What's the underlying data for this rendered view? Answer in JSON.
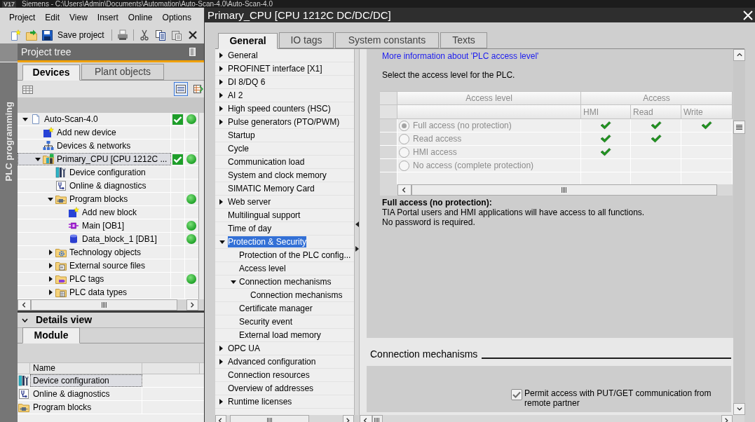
{
  "app": {
    "logo": "V17",
    "title": "Siemens - C:\\Users\\Admin\\Documents\\Automation\\Auto-Scan-4.0\\Auto-Scan-4.0",
    "menu": [
      "Project",
      "Edit",
      "View",
      "Insert",
      "Online",
      "Options"
    ],
    "toolbar": {
      "save_label": "Save project"
    },
    "portal": "PLC programming"
  },
  "project_tree": {
    "title": "Project tree",
    "tabs": [
      {
        "label": "Devices",
        "selected": true
      },
      {
        "label": "Plant objects",
        "selected": false
      }
    ],
    "view_buttons": [
      {
        "kind": "list",
        "selected": true
      },
      {
        "kind": "table",
        "selected": false
      }
    ],
    "items": [
      {
        "label": "Auto-Scan-4.0",
        "kind": "project",
        "expanded": true,
        "selected": false,
        "compiled_ok": true,
        "online_ok": true,
        "children": [
          {
            "label": "Add new device",
            "kind": "add_device",
            "selected": false,
            "compiled_ok": false,
            "online_ok": false
          },
          {
            "label": "Devices & networks",
            "kind": "network",
            "selected": false,
            "compiled_ok": false,
            "online_ok": false
          },
          {
            "label": "Primary_CPU [CPU 1212C ...",
            "kind": "cpu",
            "expanded": true,
            "selected": true,
            "compiled_ok": true,
            "online_ok": true,
            "children": [
              {
                "label": "Device configuration",
                "kind": "config",
                "selected": false,
                "compiled_ok": false,
                "online_ok": false
              },
              {
                "label": "Online & diagnostics",
                "kind": "diagnostics",
                "selected": false,
                "compiled_ok": false,
                "online_ok": false
              },
              {
                "label": "Program blocks",
                "kind": "blocks_folder",
                "expanded": true,
                "selected": false,
                "compiled_ok": false,
                "online_ok": true,
                "children": [
                  {
                    "label": "Add new block",
                    "kind": "add_block",
                    "selected": false,
                    "compiled_ok": false,
                    "online_ok": false
                  },
                  {
                    "label": "Main [OB1]",
                    "kind": "ob",
                    "selected": false,
                    "compiled_ok": false,
                    "online_ok": true
                  },
                  {
                    "label": "Data_block_1 [DB1]",
                    "kind": "db",
                    "selected": false,
                    "compiled_ok": false,
                    "online_ok": true
                  }
                ]
              },
              {
                "label": "Technology objects",
                "kind": "tech_folder",
                "expanded": false,
                "selected": false,
                "compiled_ok": false,
                "online_ok": false
              },
              {
                "label": "External source files",
                "kind": "source_folder",
                "expanded": false,
                "selected": false,
                "compiled_ok": false,
                "online_ok": false
              },
              {
                "label": "PLC tags",
                "kind": "tags_folder",
                "expanded": false,
                "selected": false,
                "compiled_ok": false,
                "online_ok": true
              },
              {
                "label": "PLC data types",
                "kind": "types_folder",
                "expanded": false,
                "selected": false,
                "compiled_ok": false,
                "online_ok": false
              }
            ]
          }
        ]
      }
    ]
  },
  "details_view": {
    "title": "Details view",
    "expanded": true,
    "tabs": [
      {
        "label": "Module",
        "selected": true
      }
    ],
    "columns": [
      "Name"
    ],
    "rows": [
      {
        "label": "Device configuration",
        "kind": "config",
        "selected": true
      },
      {
        "label": "Online & diagnostics",
        "kind": "diagnostics",
        "selected": false
      },
      {
        "label": "Program blocks",
        "kind": "blocks_folder",
        "selected": false
      }
    ]
  },
  "dialog": {
    "title": "Primary_CPU [CPU 1212C DC/DC/DC]",
    "tabs": [
      {
        "label": "General",
        "selected": true
      },
      {
        "label": "IO tags",
        "selected": false
      },
      {
        "label": "System constants",
        "selected": false
      },
      {
        "label": "Texts",
        "selected": false
      }
    ],
    "nav": [
      {
        "label": "General",
        "expanded": false,
        "selected": false
      },
      {
        "label": "PROFINET interface [X1]",
        "expanded": false,
        "selected": false
      },
      {
        "label": "DI 8/DQ 6",
        "expanded": false,
        "selected": false
      },
      {
        "label": "AI 2",
        "expanded": false,
        "selected": false
      },
      {
        "label": "High speed counters (HSC)",
        "expanded": false,
        "selected": false
      },
      {
        "label": "Pulse generators (PTO/PWM)",
        "expanded": false,
        "selected": false
      },
      {
        "label": "Startup",
        "selected": false
      },
      {
        "label": "Cycle",
        "selected": false
      },
      {
        "label": "Communication load",
        "selected": false
      },
      {
        "label": "System and clock memory",
        "selected": false
      },
      {
        "label": "SIMATIC Memory Card",
        "selected": false
      },
      {
        "label": "Web server",
        "expanded": false,
        "selected": false
      },
      {
        "label": "Multilingual support",
        "selected": false
      },
      {
        "label": "Time of day",
        "selected": false
      },
      {
        "label": "Protection & Security",
        "expanded": true,
        "selected": true,
        "children": [
          {
            "label": "Protection of the PLC config...",
            "selected": false
          },
          {
            "label": "Access level",
            "selected": false
          },
          {
            "label": "Connection mechanisms",
            "expanded": true,
            "selected": false,
            "children": [
              {
                "label": "Connection mechanisms",
                "selected": false
              }
            ]
          },
          {
            "label": "Certificate manager",
            "selected": false
          },
          {
            "label": "Security event",
            "selected": false
          },
          {
            "label": "External load memory",
            "selected": false
          }
        ]
      },
      {
        "label": "OPC UA",
        "expanded": false,
        "selected": false
      },
      {
        "label": "Advanced configuration",
        "expanded": false,
        "selected": false
      },
      {
        "label": "Connection resources",
        "selected": false
      },
      {
        "label": "Overview of addresses",
        "selected": false
      },
      {
        "label": "Runtime licenses",
        "expanded": false,
        "selected": false
      }
    ],
    "content": {
      "link": "More information about 'PLC access level'",
      "instruction": "Select the access level for the PLC.",
      "access_table": {
        "disabled": true,
        "headers": [
          "Access level",
          "Access"
        ],
        "columns": [
          "HMI",
          "Read",
          "Write"
        ],
        "rows": [
          {
            "label": "Full access (no protection)",
            "selected": true,
            "access": [
              true,
              true,
              true
            ]
          },
          {
            "label": "Read access",
            "selected": false,
            "access": [
              true,
              true,
              false
            ]
          },
          {
            "label": "HMI access",
            "selected": false,
            "access": [
              true,
              false,
              false
            ]
          },
          {
            "label": "No access (complete protection)",
            "selected": false,
            "access": [
              false,
              false,
              false
            ]
          }
        ]
      },
      "description": {
        "heading": "Full access (no protection):",
        "lines": [
          "TIA Portal users and HMI applications will have access to all functions.",
          "No password is required."
        ]
      },
      "section": {
        "heading": "Connection mechanisms",
        "options": [
          {
            "label": "Permit access with PUT/GET communication from remote partner",
            "checked": true
          }
        ]
      }
    }
  }
}
